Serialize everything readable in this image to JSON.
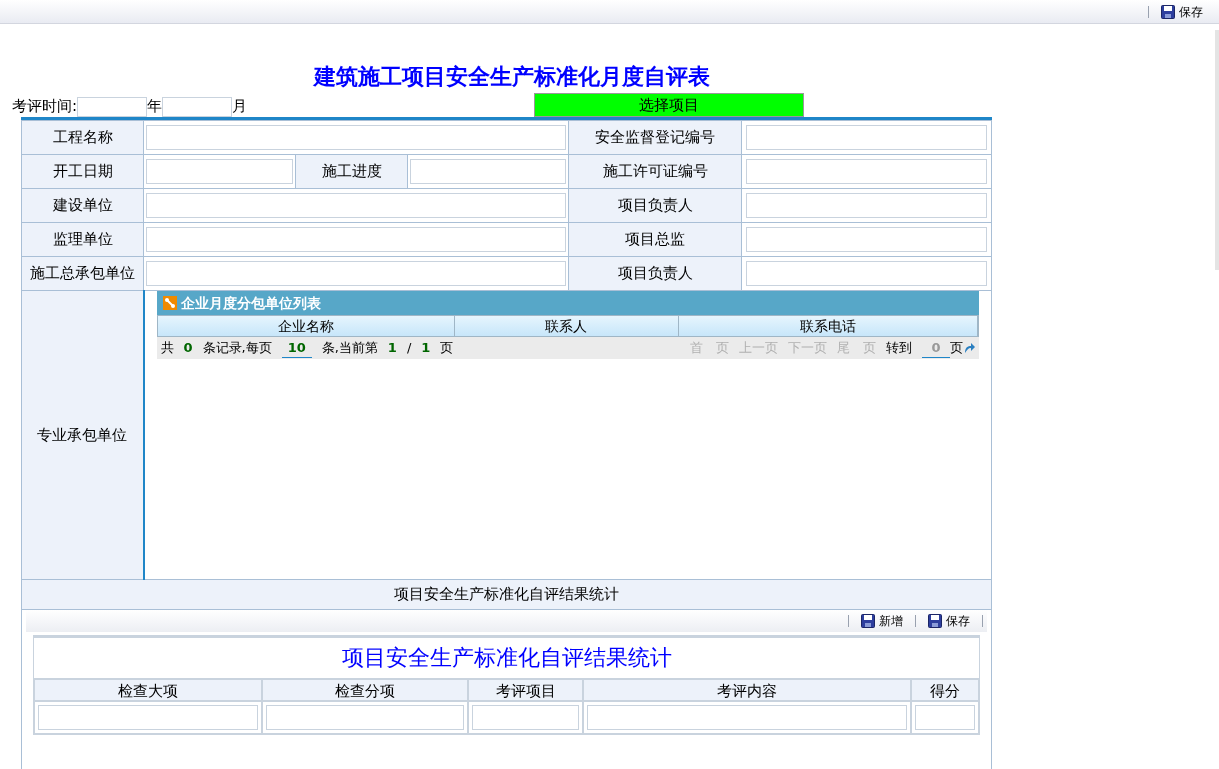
{
  "toolbar": {
    "buttons": [
      {
        "label": "保存"
      }
    ]
  },
  "title": "建筑施工项目安全生产标准化月度自评表",
  "period": {
    "label": "考评时间:",
    "year_unit": "年",
    "month_unit": "月"
  },
  "select_button": "选择项目",
  "rows": [
    {
      "label": "工程名称",
      "right_label": "安全监督登记编号"
    },
    {
      "label": "开工日期",
      "middle_label": "施工进度",
      "right_label": "施工许可证编号"
    },
    {
      "label": "建设单位",
      "right_label": "项目负责人"
    },
    {
      "label": "监理单位",
      "right_label": "项目总监"
    },
    {
      "label": "施工总承包单位",
      "right_label": "项目负责人"
    }
  ],
  "subcontractor": {
    "label": "专业承包单位",
    "grid": {
      "title": "企业月度分包单位列表",
      "columns": [
        "企业名称",
        "联系人",
        "联系电话"
      ],
      "pager": {
        "parts": [
          {
            "text": "共",
            "kind": "text"
          },
          {
            "text": "0",
            "kind": "number"
          },
          {
            "text": "条记录,每页",
            "kind": "text"
          },
          {
            "text": "10",
            "kind": "field"
          },
          {
            "text": "条,当前第",
            "kind": "text"
          },
          {
            "text": "1",
            "kind": "number"
          },
          {
            "text": "/",
            "kind": "text"
          },
          {
            "text": "1",
            "kind": "number"
          },
          {
            "text": "页",
            "kind": "text"
          }
        ],
        "nav": [
          {
            "label": "首　页",
            "disabled": true
          },
          {
            "label": "上一页",
            "disabled": true
          },
          {
            "label": "下一页",
            "disabled": true
          },
          {
            "label": "尾　页",
            "disabled": true
          }
        ],
        "goto_label": "转到",
        "goto_value": "0",
        "goto_unit": "页"
      }
    }
  },
  "stats": {
    "header": "项目安全生产标准化自评结果统计",
    "buttons": [
      {
        "label": "新增"
      },
      {
        "label": "保存"
      }
    ],
    "title": "项目安全生产标准化自评结果统计",
    "columns": [
      "检查大项",
      "检查分项",
      "考评项目",
      "考评内容",
      "得分"
    ]
  }
}
